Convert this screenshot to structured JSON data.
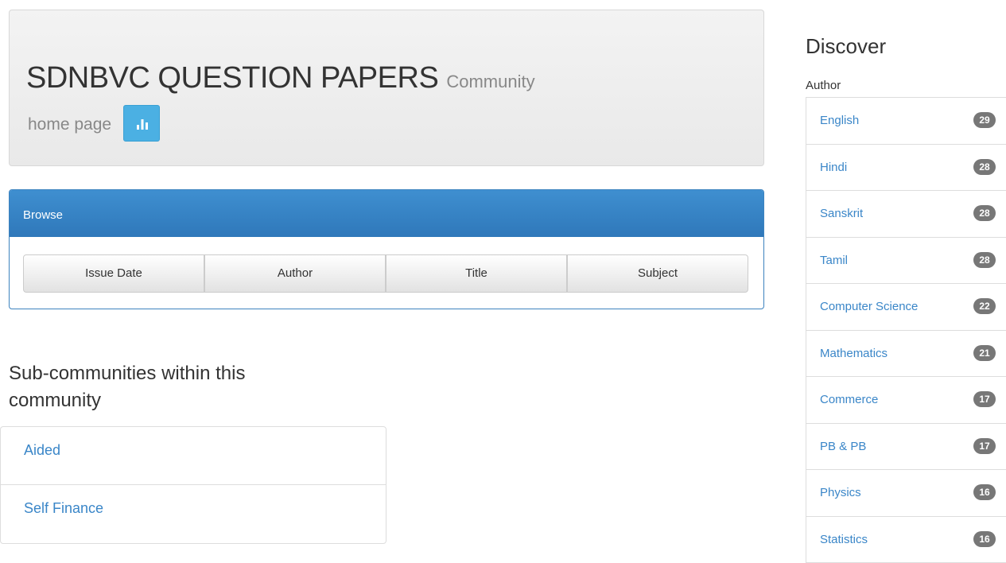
{
  "header": {
    "title": "SDNBVC QUESTION PAPERS",
    "subtitle_part1": "Community",
    "subtitle_part2": "home page",
    "stats_icon": "bar-chart-icon"
  },
  "browse": {
    "heading": "Browse",
    "buttons": [
      "Issue Date",
      "Author",
      "Title",
      "Subject"
    ]
  },
  "subcommunities": {
    "heading": "Sub-communities within this community",
    "items": [
      "Aided",
      "Self Finance"
    ]
  },
  "discover": {
    "heading": "Discover",
    "facet_label": "Author",
    "items": [
      {
        "label": "English",
        "count": "29"
      },
      {
        "label": "Hindi",
        "count": "28"
      },
      {
        "label": "Sanskrit",
        "count": "28"
      },
      {
        "label": "Tamil",
        "count": "28"
      },
      {
        "label": "Computer Science",
        "count": "22"
      },
      {
        "label": "Mathematics",
        "count": "21"
      },
      {
        "label": "Commerce",
        "count": "17"
      },
      {
        "label": "PB & PB",
        "count": "17"
      },
      {
        "label": "Physics",
        "count": "16"
      },
      {
        "label": "Statistics",
        "count": "16"
      }
    ]
  },
  "colors": {
    "link": "#3a86c8",
    "browse_header": "#337ab7",
    "stats_button": "#4bb0e3",
    "badge": "#777777"
  }
}
